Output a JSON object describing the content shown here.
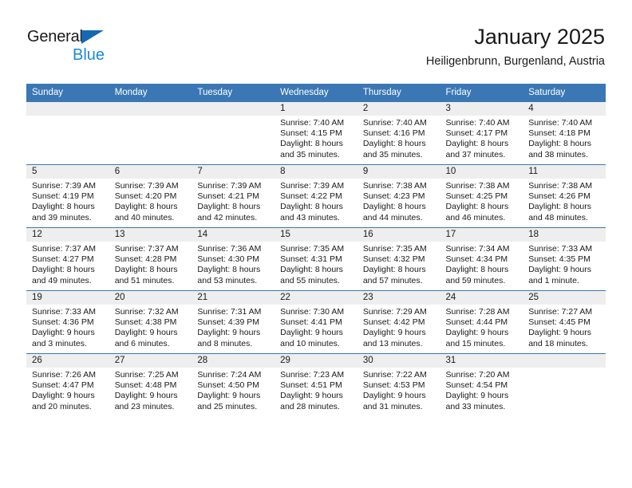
{
  "brand": {
    "name_line1": "General",
    "name_line2": "Blue",
    "accent_blue": "#1668b3",
    "light_blue": "#1a8bd6"
  },
  "header": {
    "title": "January 2025",
    "subtitle": "Heiligenbrunn, Burgenland, Austria",
    "header_bg": "#3a77b4",
    "daynum_bg": "#eeeeee"
  },
  "weekdays": [
    "Sunday",
    "Monday",
    "Tuesday",
    "Wednesday",
    "Thursday",
    "Friday",
    "Saturday"
  ],
  "weeks": [
    [
      {
        "day": "",
        "l1": "",
        "l2": "",
        "l3": "",
        "l4": ""
      },
      {
        "day": "",
        "l1": "",
        "l2": "",
        "l3": "",
        "l4": ""
      },
      {
        "day": "",
        "l1": "",
        "l2": "",
        "l3": "",
        "l4": ""
      },
      {
        "day": "1",
        "l1": "Sunrise: 7:40 AM",
        "l2": "Sunset: 4:15 PM",
        "l3": "Daylight: 8 hours",
        "l4": "and 35 minutes."
      },
      {
        "day": "2",
        "l1": "Sunrise: 7:40 AM",
        "l2": "Sunset: 4:16 PM",
        "l3": "Daylight: 8 hours",
        "l4": "and 35 minutes."
      },
      {
        "day": "3",
        "l1": "Sunrise: 7:40 AM",
        "l2": "Sunset: 4:17 PM",
        "l3": "Daylight: 8 hours",
        "l4": "and 37 minutes."
      },
      {
        "day": "4",
        "l1": "Sunrise: 7:40 AM",
        "l2": "Sunset: 4:18 PM",
        "l3": "Daylight: 8 hours",
        "l4": "and 38 minutes."
      }
    ],
    [
      {
        "day": "5",
        "l1": "Sunrise: 7:39 AM",
        "l2": "Sunset: 4:19 PM",
        "l3": "Daylight: 8 hours",
        "l4": "and 39 minutes."
      },
      {
        "day": "6",
        "l1": "Sunrise: 7:39 AM",
        "l2": "Sunset: 4:20 PM",
        "l3": "Daylight: 8 hours",
        "l4": "and 40 minutes."
      },
      {
        "day": "7",
        "l1": "Sunrise: 7:39 AM",
        "l2": "Sunset: 4:21 PM",
        "l3": "Daylight: 8 hours",
        "l4": "and 42 minutes."
      },
      {
        "day": "8",
        "l1": "Sunrise: 7:39 AM",
        "l2": "Sunset: 4:22 PM",
        "l3": "Daylight: 8 hours",
        "l4": "and 43 minutes."
      },
      {
        "day": "9",
        "l1": "Sunrise: 7:38 AM",
        "l2": "Sunset: 4:23 PM",
        "l3": "Daylight: 8 hours",
        "l4": "and 44 minutes."
      },
      {
        "day": "10",
        "l1": "Sunrise: 7:38 AM",
        "l2": "Sunset: 4:25 PM",
        "l3": "Daylight: 8 hours",
        "l4": "and 46 minutes."
      },
      {
        "day": "11",
        "l1": "Sunrise: 7:38 AM",
        "l2": "Sunset: 4:26 PM",
        "l3": "Daylight: 8 hours",
        "l4": "and 48 minutes."
      }
    ],
    [
      {
        "day": "12",
        "l1": "Sunrise: 7:37 AM",
        "l2": "Sunset: 4:27 PM",
        "l3": "Daylight: 8 hours",
        "l4": "and 49 minutes."
      },
      {
        "day": "13",
        "l1": "Sunrise: 7:37 AM",
        "l2": "Sunset: 4:28 PM",
        "l3": "Daylight: 8 hours",
        "l4": "and 51 minutes."
      },
      {
        "day": "14",
        "l1": "Sunrise: 7:36 AM",
        "l2": "Sunset: 4:30 PM",
        "l3": "Daylight: 8 hours",
        "l4": "and 53 minutes."
      },
      {
        "day": "15",
        "l1": "Sunrise: 7:35 AM",
        "l2": "Sunset: 4:31 PM",
        "l3": "Daylight: 8 hours",
        "l4": "and 55 minutes."
      },
      {
        "day": "16",
        "l1": "Sunrise: 7:35 AM",
        "l2": "Sunset: 4:32 PM",
        "l3": "Daylight: 8 hours",
        "l4": "and 57 minutes."
      },
      {
        "day": "17",
        "l1": "Sunrise: 7:34 AM",
        "l2": "Sunset: 4:34 PM",
        "l3": "Daylight: 8 hours",
        "l4": "and 59 minutes."
      },
      {
        "day": "18",
        "l1": "Sunrise: 7:33 AM",
        "l2": "Sunset: 4:35 PM",
        "l3": "Daylight: 9 hours",
        "l4": "and 1 minute."
      }
    ],
    [
      {
        "day": "19",
        "l1": "Sunrise: 7:33 AM",
        "l2": "Sunset: 4:36 PM",
        "l3": "Daylight: 9 hours",
        "l4": "and 3 minutes."
      },
      {
        "day": "20",
        "l1": "Sunrise: 7:32 AM",
        "l2": "Sunset: 4:38 PM",
        "l3": "Daylight: 9 hours",
        "l4": "and 6 minutes."
      },
      {
        "day": "21",
        "l1": "Sunrise: 7:31 AM",
        "l2": "Sunset: 4:39 PM",
        "l3": "Daylight: 9 hours",
        "l4": "and 8 minutes."
      },
      {
        "day": "22",
        "l1": "Sunrise: 7:30 AM",
        "l2": "Sunset: 4:41 PM",
        "l3": "Daylight: 9 hours",
        "l4": "and 10 minutes."
      },
      {
        "day": "23",
        "l1": "Sunrise: 7:29 AM",
        "l2": "Sunset: 4:42 PM",
        "l3": "Daylight: 9 hours",
        "l4": "and 13 minutes."
      },
      {
        "day": "24",
        "l1": "Sunrise: 7:28 AM",
        "l2": "Sunset: 4:44 PM",
        "l3": "Daylight: 9 hours",
        "l4": "and 15 minutes."
      },
      {
        "day": "25",
        "l1": "Sunrise: 7:27 AM",
        "l2": "Sunset: 4:45 PM",
        "l3": "Daylight: 9 hours",
        "l4": "and 18 minutes."
      }
    ],
    [
      {
        "day": "26",
        "l1": "Sunrise: 7:26 AM",
        "l2": "Sunset: 4:47 PM",
        "l3": "Daylight: 9 hours",
        "l4": "and 20 minutes."
      },
      {
        "day": "27",
        "l1": "Sunrise: 7:25 AM",
        "l2": "Sunset: 4:48 PM",
        "l3": "Daylight: 9 hours",
        "l4": "and 23 minutes."
      },
      {
        "day": "28",
        "l1": "Sunrise: 7:24 AM",
        "l2": "Sunset: 4:50 PM",
        "l3": "Daylight: 9 hours",
        "l4": "and 25 minutes."
      },
      {
        "day": "29",
        "l1": "Sunrise: 7:23 AM",
        "l2": "Sunset: 4:51 PM",
        "l3": "Daylight: 9 hours",
        "l4": "and 28 minutes."
      },
      {
        "day": "30",
        "l1": "Sunrise: 7:22 AM",
        "l2": "Sunset: 4:53 PM",
        "l3": "Daylight: 9 hours",
        "l4": "and 31 minutes."
      },
      {
        "day": "31",
        "l1": "Sunrise: 7:20 AM",
        "l2": "Sunset: 4:54 PM",
        "l3": "Daylight: 9 hours",
        "l4": "and 33 minutes."
      },
      {
        "day": "",
        "l1": "",
        "l2": "",
        "l3": "",
        "l4": ""
      }
    ]
  ]
}
